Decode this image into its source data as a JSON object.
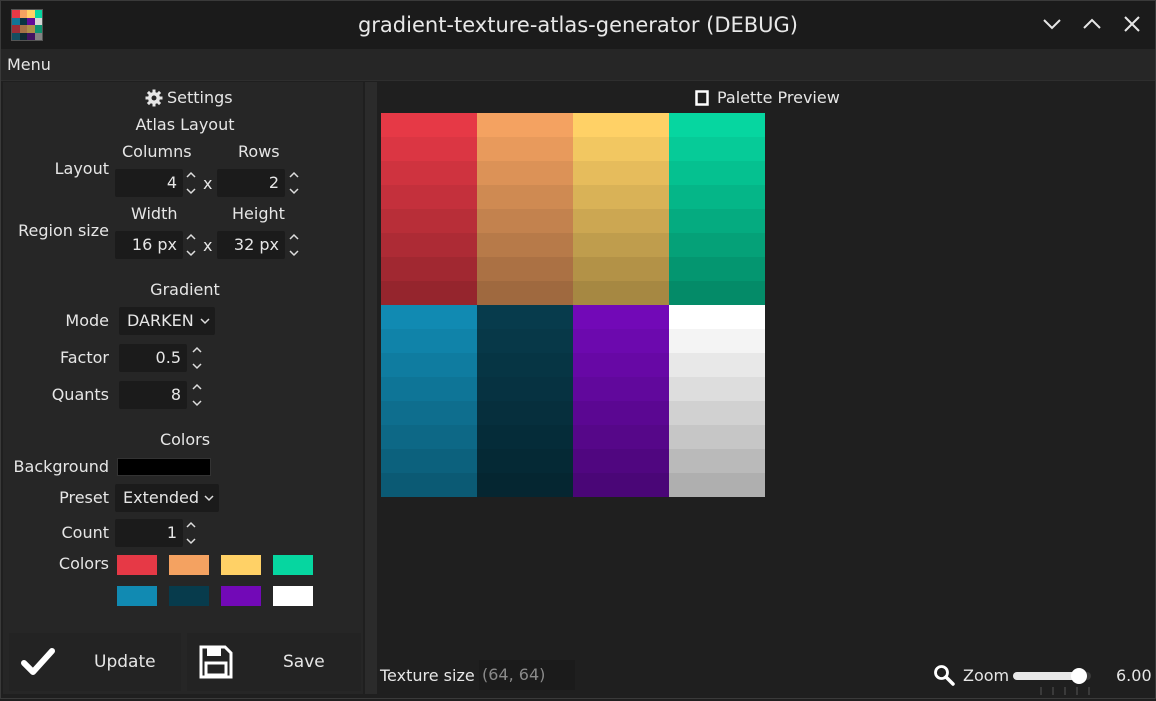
{
  "window": {
    "title": "gradient-texture-atlas-generator (DEBUG)"
  },
  "menu": {
    "label": "Menu"
  },
  "settings": {
    "title": "Settings",
    "atlas_layout": {
      "heading": "Atlas Layout",
      "layout_label": "Layout",
      "columns_header": "Columns",
      "rows_header": "Rows",
      "columns_value": "4",
      "rows_value": "2",
      "times": "x",
      "region_label": "Region size",
      "width_header": "Width",
      "height_header": "Height",
      "width_value": "16 px",
      "height_value": "32 px"
    },
    "gradient": {
      "heading": "Gradient",
      "mode_label": "Mode",
      "mode_value": "DARKEN",
      "factor_label": "Factor",
      "factor_value": "0.5",
      "quants_label": "Quants",
      "quants_value": "8"
    },
    "colors": {
      "heading": "Colors",
      "background_label": "Background",
      "background_color": "#000000",
      "preset_label": "Preset",
      "preset_value": "Extended",
      "count_label": "Count",
      "count_value": "1",
      "colors_label": "Colors",
      "swatches": [
        "#e63946",
        "#f4a261",
        "#ffd166",
        "#06d6a0",
        "#118ab2",
        "#073b4c",
        "#7209b7",
        "#ffffff"
      ]
    },
    "buttons": {
      "update_label": "Update",
      "save_label": "Save"
    }
  },
  "preview": {
    "title": "Palette Preview",
    "texture_size_label": "Texture size",
    "texture_size_value": "(64, 64)",
    "zoom_label": "Zoom",
    "zoom_value": "6.00",
    "zoom_fraction": 0.85
  },
  "icons": {
    "app": "app-palette-icon",
    "settings": "gear-icon",
    "preview": "document-icon",
    "update": "checkmark-icon",
    "save": "floppy-disk-icon",
    "zoom": "magnifier-icon",
    "minimize": "chevron-down-icon",
    "maximize": "chevron-up-icon",
    "close": "close-icon"
  }
}
